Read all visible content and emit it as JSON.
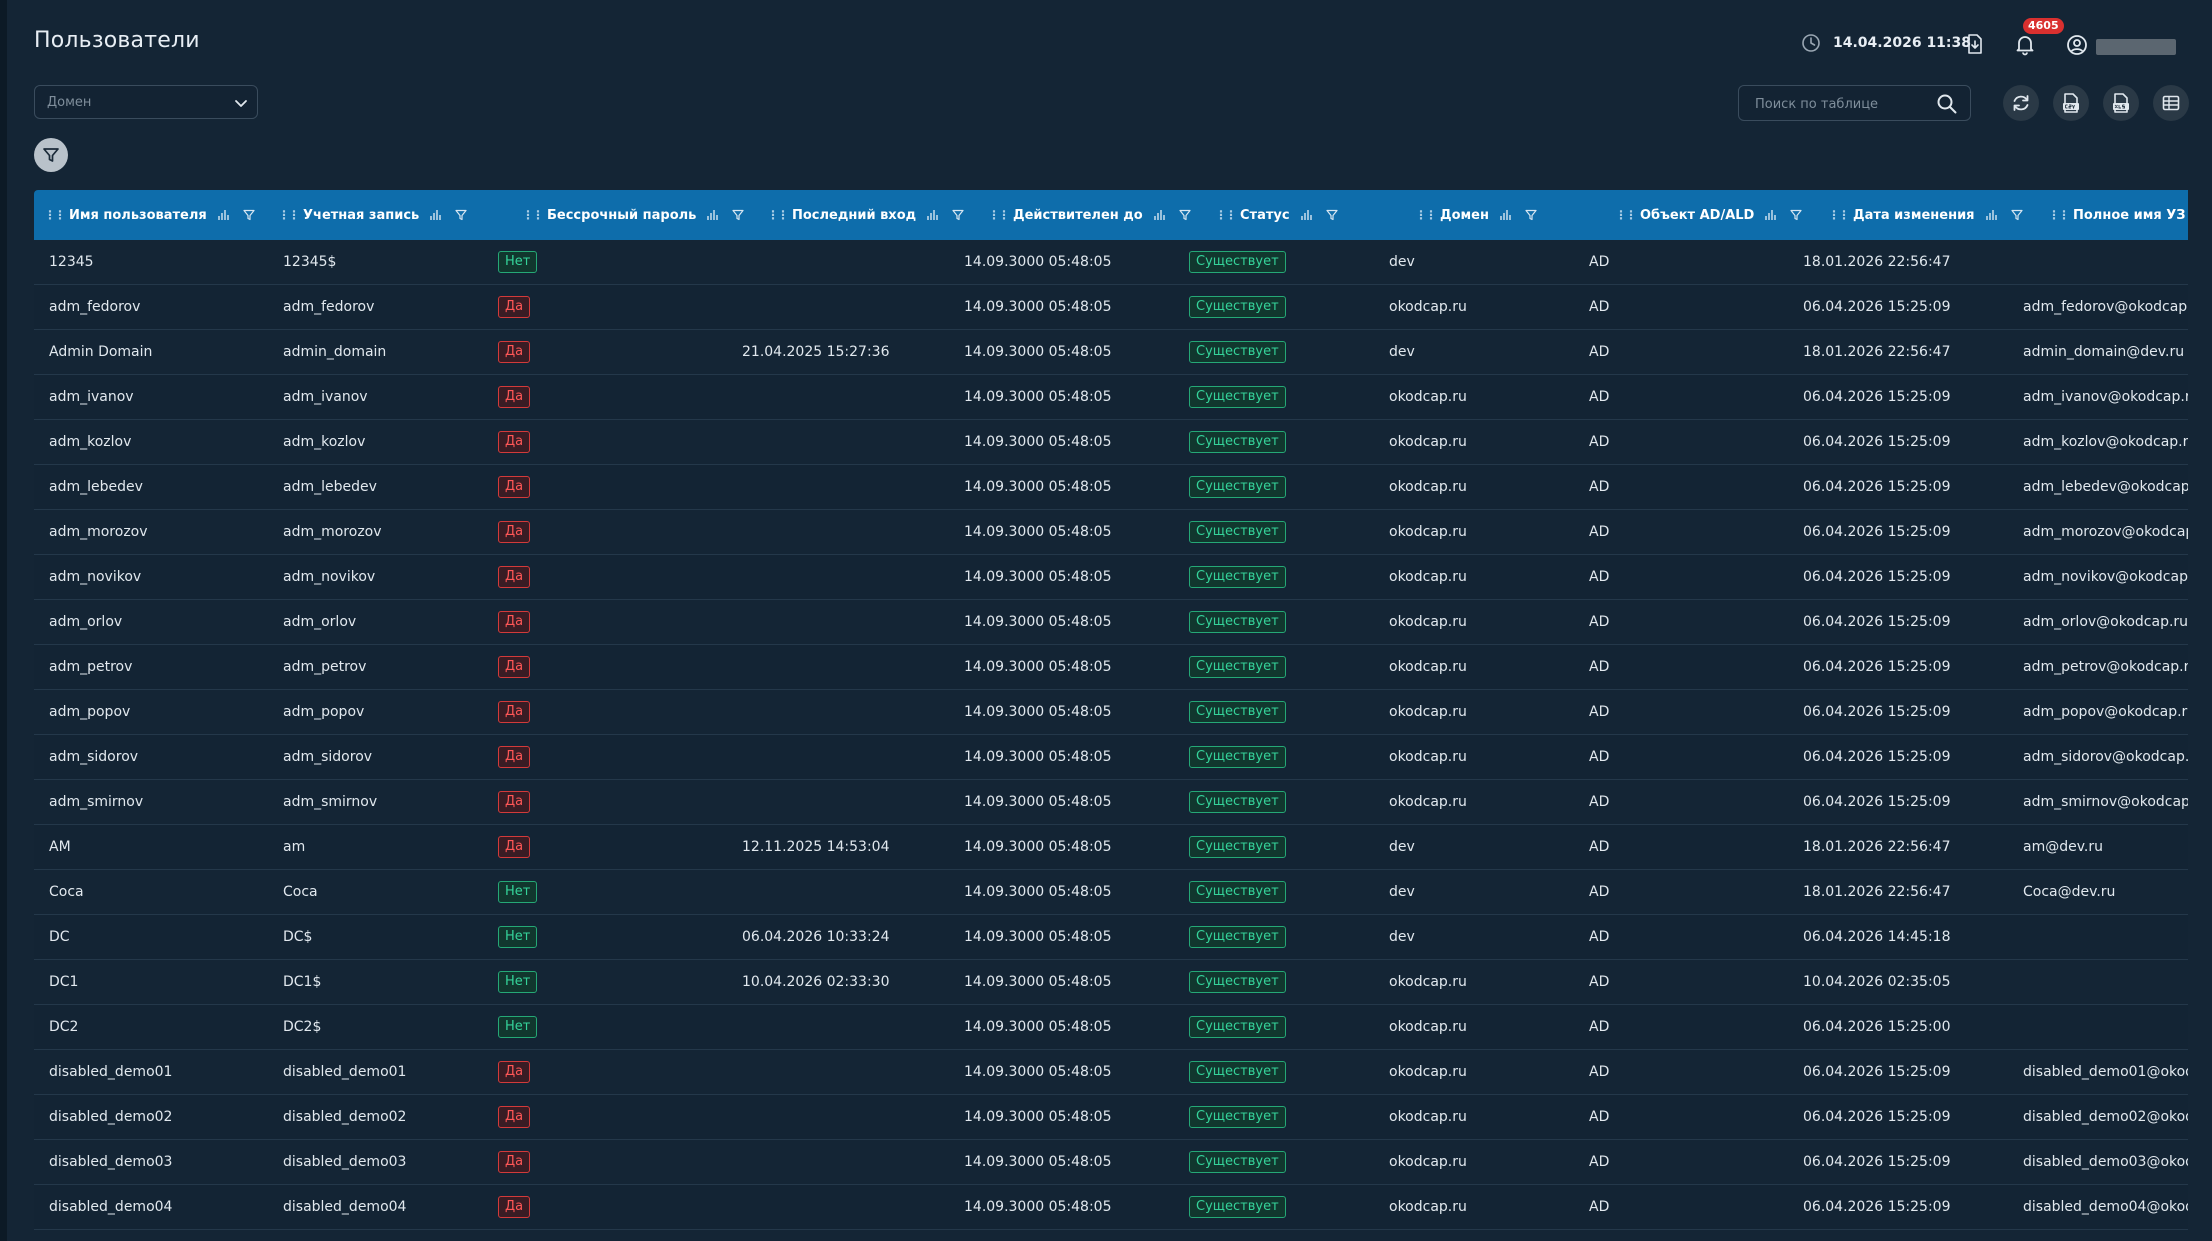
{
  "header": {
    "title": "Пользователи",
    "datetime": "14.04.2026 11:38",
    "notifications_count": "4605"
  },
  "toolbar": {
    "domain_placeholder": "Домен",
    "search_placeholder": "Поиск по таблице"
  },
  "colors": {
    "header_bg": "#0e6dab",
    "badge_red": "#d9302f",
    "tag_yes": "#ff5757",
    "tag_green": "#35d39a"
  },
  "table": {
    "columns": [
      "Имя пользователя",
      "Учетная запись",
      "Бессрочный пароль",
      "Последний вход",
      "Действителен до",
      "Статус",
      "Домен",
      "Объект AD/ALD",
      "Дата изменения",
      "Полное имя УЗ"
    ],
    "rows": [
      {
        "name": "12345",
        "account": "12345$",
        "pwd": "Нет",
        "last": "",
        "valid": "14.09.3000 05:48:05",
        "status": "Существует",
        "domain": "dev",
        "obj": "AD",
        "changed": "18.01.2026 22:56:47",
        "full": ""
      },
      {
        "name": "adm_fedorov",
        "account": "adm_fedorov",
        "pwd": "Да",
        "last": "",
        "valid": "14.09.3000 05:48:05",
        "status": "Существует",
        "domain": "okodcap.ru",
        "obj": "AD",
        "changed": "06.04.2026 15:25:09",
        "full": "adm_fedorov@okodcap.r"
      },
      {
        "name": "Admin Domain",
        "account": "admin_domain",
        "pwd": "Да",
        "last": "21.04.2025 15:27:36",
        "valid": "14.09.3000 05:48:05",
        "status": "Существует",
        "domain": "dev",
        "obj": "AD",
        "changed": "18.01.2026 22:56:47",
        "full": "admin_domain@dev.ru"
      },
      {
        "name": "adm_ivanov",
        "account": "adm_ivanov",
        "pwd": "Да",
        "last": "",
        "valid": "14.09.3000 05:48:05",
        "status": "Существует",
        "domain": "okodcap.ru",
        "obj": "AD",
        "changed": "06.04.2026 15:25:09",
        "full": "adm_ivanov@okodcap.ru"
      },
      {
        "name": "adm_kozlov",
        "account": "adm_kozlov",
        "pwd": "Да",
        "last": "",
        "valid": "14.09.3000 05:48:05",
        "status": "Существует",
        "domain": "okodcap.ru",
        "obj": "AD",
        "changed": "06.04.2026 15:25:09",
        "full": "adm_kozlov@okodcap.ru"
      },
      {
        "name": "adm_lebedev",
        "account": "adm_lebedev",
        "pwd": "Да",
        "last": "",
        "valid": "14.09.3000 05:48:05",
        "status": "Существует",
        "domain": "okodcap.ru",
        "obj": "AD",
        "changed": "06.04.2026 15:25:09",
        "full": "adm_lebedev@okodcap.r"
      },
      {
        "name": "adm_morozov",
        "account": "adm_morozov",
        "pwd": "Да",
        "last": "",
        "valid": "14.09.3000 05:48:05",
        "status": "Существует",
        "domain": "okodcap.ru",
        "obj": "AD",
        "changed": "06.04.2026 15:25:09",
        "full": "adm_morozov@okodcap."
      },
      {
        "name": "adm_novikov",
        "account": "adm_novikov",
        "pwd": "Да",
        "last": "",
        "valid": "14.09.3000 05:48:05",
        "status": "Существует",
        "domain": "okodcap.ru",
        "obj": "AD",
        "changed": "06.04.2026 15:25:09",
        "full": "adm_novikov@okodcap.r"
      },
      {
        "name": "adm_orlov",
        "account": "adm_orlov",
        "pwd": "Да",
        "last": "",
        "valid": "14.09.3000 05:48:05",
        "status": "Существует",
        "domain": "okodcap.ru",
        "obj": "AD",
        "changed": "06.04.2026 15:25:09",
        "full": "adm_orlov@okodcap.ru"
      },
      {
        "name": "adm_petrov",
        "account": "adm_petrov",
        "pwd": "Да",
        "last": "",
        "valid": "14.09.3000 05:48:05",
        "status": "Существует",
        "domain": "okodcap.ru",
        "obj": "AD",
        "changed": "06.04.2026 15:25:09",
        "full": "adm_petrov@okodcap.ru"
      },
      {
        "name": "adm_popov",
        "account": "adm_popov",
        "pwd": "Да",
        "last": "",
        "valid": "14.09.3000 05:48:05",
        "status": "Существует",
        "domain": "okodcap.ru",
        "obj": "AD",
        "changed": "06.04.2026 15:25:09",
        "full": "adm_popov@okodcap.ru"
      },
      {
        "name": "adm_sidorov",
        "account": "adm_sidorov",
        "pwd": "Да",
        "last": "",
        "valid": "14.09.3000 05:48:05",
        "status": "Существует",
        "domain": "okodcap.ru",
        "obj": "AD",
        "changed": "06.04.2026 15:25:09",
        "full": "adm_sidorov@okodcap.ru"
      },
      {
        "name": "adm_smirnov",
        "account": "adm_smirnov",
        "pwd": "Да",
        "last": "",
        "valid": "14.09.3000 05:48:05",
        "status": "Существует",
        "domain": "okodcap.ru",
        "obj": "AD",
        "changed": "06.04.2026 15:25:09",
        "full": "adm_smirnov@okodcap."
      },
      {
        "name": "AM",
        "account": "am",
        "pwd": "Да",
        "last": "12.11.2025 14:53:04",
        "valid": "14.09.3000 05:48:05",
        "status": "Существует",
        "domain": "dev",
        "obj": "AD",
        "changed": "18.01.2026 22:56:47",
        "full": "am@dev.ru"
      },
      {
        "name": "Coca",
        "account": "Coca",
        "pwd": "Нет",
        "last": "",
        "valid": "14.09.3000 05:48:05",
        "status": "Существует",
        "domain": "dev",
        "obj": "AD",
        "changed": "18.01.2026 22:56:47",
        "full": "Coca@dev.ru"
      },
      {
        "name": "DC",
        "account": "DC$",
        "pwd": "Нет",
        "last": "06.04.2026 10:33:24",
        "valid": "14.09.3000 05:48:05",
        "status": "Существует",
        "domain": "dev",
        "obj": "AD",
        "changed": "06.04.2026 14:45:18",
        "full": ""
      },
      {
        "name": "DC1",
        "account": "DC1$",
        "pwd": "Нет",
        "last": "10.04.2026 02:33:30",
        "valid": "14.09.3000 05:48:05",
        "status": "Существует",
        "domain": "okodcap.ru",
        "obj": "AD",
        "changed": "10.04.2026 02:35:05",
        "full": ""
      },
      {
        "name": "DC2",
        "account": "DC2$",
        "pwd": "Нет",
        "last": "",
        "valid": "14.09.3000 05:48:05",
        "status": "Существует",
        "domain": "okodcap.ru",
        "obj": "AD",
        "changed": "06.04.2026 15:25:00",
        "full": ""
      },
      {
        "name": "disabled_demo01",
        "account": "disabled_demo01",
        "pwd": "Да",
        "last": "",
        "valid": "14.09.3000 05:48:05",
        "status": "Существует",
        "domain": "okodcap.ru",
        "obj": "AD",
        "changed": "06.04.2026 15:25:09",
        "full": "disabled_demo01@okodc"
      },
      {
        "name": "disabled_demo02",
        "account": "disabled_demo02",
        "pwd": "Да",
        "last": "",
        "valid": "14.09.3000 05:48:05",
        "status": "Существует",
        "domain": "okodcap.ru",
        "obj": "AD",
        "changed": "06.04.2026 15:25:09",
        "full": "disabled_demo02@okodc"
      },
      {
        "name": "disabled_demo03",
        "account": "disabled_demo03",
        "pwd": "Да",
        "last": "",
        "valid": "14.09.3000 05:48:05",
        "status": "Существует",
        "domain": "okodcap.ru",
        "obj": "AD",
        "changed": "06.04.2026 15:25:09",
        "full": "disabled_demo03@okodc"
      },
      {
        "name": "disabled_demo04",
        "account": "disabled_demo04",
        "pwd": "Да",
        "last": "",
        "valid": "14.09.3000 05:48:05",
        "status": "Существует",
        "domain": "okodcap.ru",
        "obj": "AD",
        "changed": "06.04.2026 15:25:09",
        "full": "disabled_demo04@okodc"
      }
    ]
  }
}
